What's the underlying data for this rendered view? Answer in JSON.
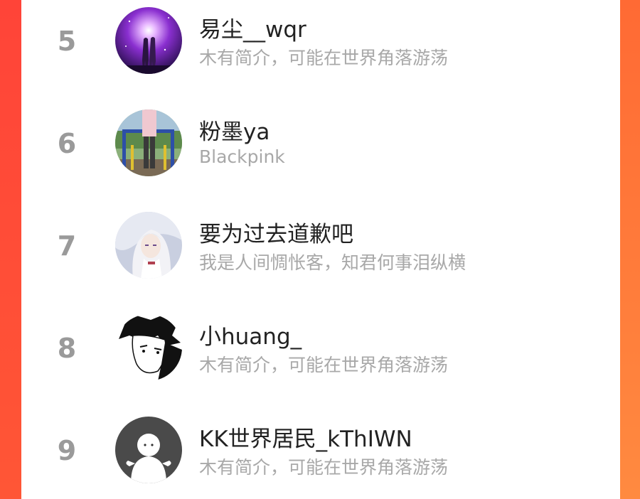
{
  "colors": {
    "accent_left": "#ff4a3a",
    "accent_right": "#ff8a40",
    "rank_text": "#9a9a9a",
    "name_text": "#222222",
    "bio_text": "#a8a8a8"
  },
  "users": [
    {
      "rank": "5",
      "name": "易尘__wqr",
      "bio": "木有简介，可能在世界角落游荡",
      "avatar": "galaxy-couple-avatar"
    },
    {
      "rank": "6",
      "name": "粉墨ya",
      "bio": "Blackpink",
      "avatar": "playground-photo-avatar"
    },
    {
      "rank": "7",
      "name": "要为过去道歉吧",
      "bio": "我是人间惆怅客，知君何事泪纵横",
      "avatar": "anime-silver-hair-avatar"
    },
    {
      "rank": "8",
      "name": "小huang_",
      "bio": "木有简介，可能在世界角落游荡",
      "avatar": "manga-boy-avatar"
    },
    {
      "rank": "9",
      "name": "KK世界居民_kThIWN",
      "bio": "木有简介，可能在世界角落游荡",
      "avatar": "default-ghost-avatar"
    }
  ]
}
